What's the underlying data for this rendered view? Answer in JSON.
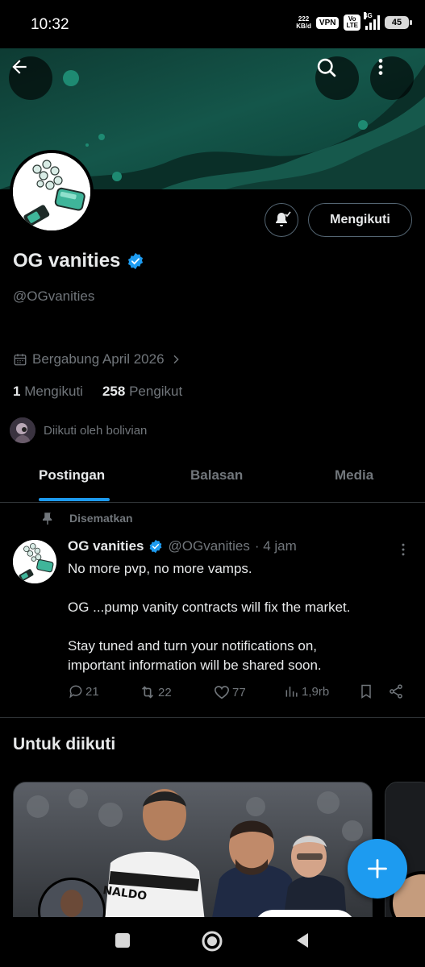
{
  "status_bar": {
    "time": "10:32",
    "net_speed_value": "222",
    "net_speed_unit": "KB/d",
    "vpn": "VPN",
    "volte_top": "Vo",
    "volte_bottom": "LTE",
    "network": "4G",
    "battery": "45"
  },
  "profile": {
    "display_name": "OG vanities",
    "handle": "@OGvanities",
    "joined": "Bergabung April 2026",
    "following_count": "1",
    "following_label": "Mengikuti",
    "followers_count": "258",
    "followers_label": "Pengikut",
    "followed_by": "Diikuti oleh bolivian",
    "follow_button": "Mengikuti"
  },
  "tabs": [
    {
      "label": "Postingan",
      "active": true
    },
    {
      "label": "Balasan",
      "active": false
    },
    {
      "label": "Media",
      "active": false
    }
  ],
  "pinned_tweet": {
    "pinned_label": "Disematkan",
    "author_name": "OG vanities",
    "author_handle": "@OGvanities",
    "time": "· 4 jam",
    "paragraphs": [
      "No more pvp, no more vamps.",
      "",
      "OG ...pump vanity contracts will fix the market.",
      "",
      "Stay tuned and turn your notifications on,",
      "important information will be shared soon."
    ],
    "replies": "21",
    "retweets": "22",
    "likes": "77",
    "views": "1,9rb"
  },
  "who_to_follow": {
    "title": "Untuk diikuti",
    "jersey_text": "NALDO"
  },
  "colors": {
    "accent": "#1d9bf0",
    "banner": "#0f4a3c",
    "muted": "#71767b",
    "border": "#2f3336"
  }
}
